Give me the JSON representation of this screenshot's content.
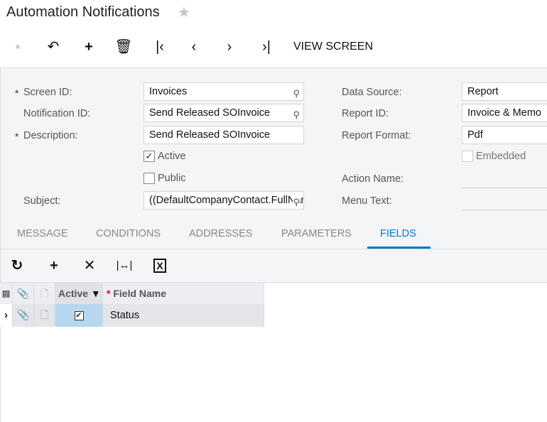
{
  "header": {
    "title": "Automation Notifications",
    "favorite_icon": "star-icon"
  },
  "toolbar": {
    "view_screen": "VIEW SCREEN",
    "icons": [
      "save-icon",
      "undo-icon",
      "add-icon",
      "delete-icon",
      "first-icon",
      "previous-icon",
      "next-icon",
      "last-icon"
    ]
  },
  "form": {
    "screen_id": {
      "label": "Screen ID:",
      "value": "Invoices",
      "required": "*"
    },
    "notification_id": {
      "label": "Notification ID:",
      "value": "Send Released SOInvoice"
    },
    "description": {
      "label": "Description:",
      "value": "Send Released SOInvoice",
      "required": "*"
    },
    "active": {
      "label": "Active",
      "checked": true,
      "mark": "✓"
    },
    "public": {
      "label": "Public",
      "checked": false
    },
    "subject": {
      "label": "Subject:",
      "value": "((DefaultCompanyContact.FullName))"
    },
    "data_source": {
      "label": "Data Source:",
      "value": "Report"
    },
    "report_id": {
      "label": "Report ID:",
      "value": "Invoice & Memo"
    },
    "report_format": {
      "label": "Report Format:",
      "value": "Pdf"
    },
    "embedded": {
      "label": "Embedded",
      "checked": false
    },
    "action_name": {
      "label": "Action Name:",
      "value": ""
    },
    "menu_text": {
      "label": "Menu Text:",
      "value": ""
    }
  },
  "tabs": [
    {
      "label": "MESSAGE"
    },
    {
      "label": "CONDITIONS"
    },
    {
      "label": "ADDRESSES"
    },
    {
      "label": "PARAMETERS"
    },
    {
      "label": "FIELDS",
      "active": true
    }
  ],
  "accent": "#0078c8",
  "grid": {
    "toolbar_icons": [
      "refresh-icon",
      "add-row-icon",
      "delete-row-icon",
      "fit-columns-icon",
      "export-excel-icon"
    ],
    "columns": {
      "active": "Active",
      "field_name": "Field Name",
      "required": "*"
    },
    "rows": [
      {
        "active": true,
        "active_mark": "✔",
        "field_name": "Status"
      }
    ]
  }
}
